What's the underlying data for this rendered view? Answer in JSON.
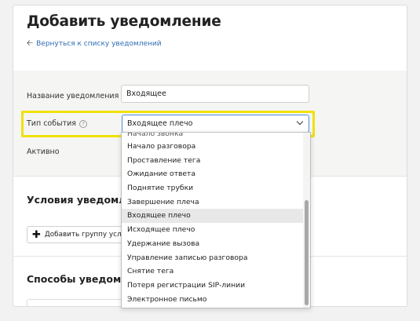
{
  "header": {
    "title": "Добавить уведомление",
    "back_link": "Вернуться к списку уведомлений"
  },
  "form": {
    "name_label": "Название уведомления",
    "name_value": "Входящее",
    "event_type_label": "Тип события",
    "event_type_value": "Входящее плечо",
    "active_label": "Активно"
  },
  "conditions": {
    "title": "Условия уведомлен",
    "add_group_label": "Добавить группу усло"
  },
  "methods": {
    "title": "Способы уведомлен"
  },
  "dropdown": {
    "partial_top": "Начало звонка",
    "options": [
      "Начало разговора",
      "Проставление тега",
      "Ожидание ответа",
      "Поднятие трубки",
      "Завершение плеча",
      "Входящее плечо",
      "Исходящее плечо",
      "Удержание вызова",
      "Управление записью разговора",
      "Снятие тега",
      "Потеря регистрации SIP-линии",
      "Электронное письмо"
    ],
    "selected_option": "Входящее плечо"
  },
  "colors": {
    "highlight": "#f0e10a",
    "link": "#2f6db5",
    "selected_bg": "#e8e8e8"
  },
  "icons": {
    "back": "arrow-left-icon",
    "help": "question-circle-icon",
    "dropdown": "chevron-down-icon",
    "add": "plus-icon"
  }
}
